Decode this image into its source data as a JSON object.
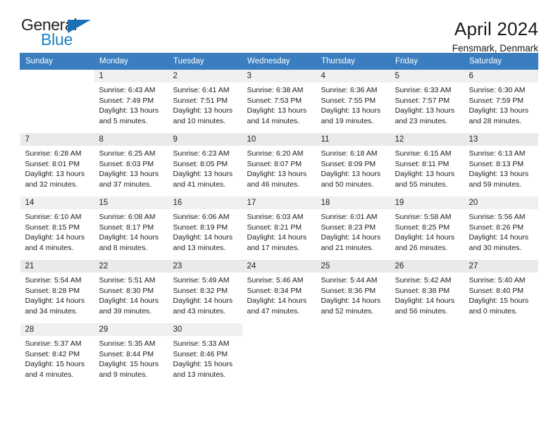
{
  "brand": {
    "name_top": "General",
    "name_bottom": "Blue",
    "triangle_color": "#1d70b8",
    "blue_color": "#1b81c4"
  },
  "header": {
    "month_title": "April 2024",
    "location": "Fensmark, Denmark"
  },
  "theme": {
    "header_bg": "#3a7ebf",
    "header_text": "#ffffff",
    "daynum_bg": "#f0f0f0",
    "daynum_bg_alt": "#eaeaea"
  },
  "weekdays": [
    "Sunday",
    "Monday",
    "Tuesday",
    "Wednesday",
    "Thursday",
    "Friday",
    "Saturday"
  ],
  "weeks": [
    [
      {
        "day": "",
        "sunrise": "",
        "sunset": "",
        "daylight_1": "",
        "daylight_2": "",
        "blank": true
      },
      {
        "day": "1",
        "sunrise": "Sunrise: 6:43 AM",
        "sunset": "Sunset: 7:49 PM",
        "daylight_1": "Daylight: 13 hours",
        "daylight_2": "and 5 minutes."
      },
      {
        "day": "2",
        "sunrise": "Sunrise: 6:41 AM",
        "sunset": "Sunset: 7:51 PM",
        "daylight_1": "Daylight: 13 hours",
        "daylight_2": "and 10 minutes."
      },
      {
        "day": "3",
        "sunrise": "Sunrise: 6:38 AM",
        "sunset": "Sunset: 7:53 PM",
        "daylight_1": "Daylight: 13 hours",
        "daylight_2": "and 14 minutes."
      },
      {
        "day": "4",
        "sunrise": "Sunrise: 6:36 AM",
        "sunset": "Sunset: 7:55 PM",
        "daylight_1": "Daylight: 13 hours",
        "daylight_2": "and 19 minutes."
      },
      {
        "day": "5",
        "sunrise": "Sunrise: 6:33 AM",
        "sunset": "Sunset: 7:57 PM",
        "daylight_1": "Daylight: 13 hours",
        "daylight_2": "and 23 minutes."
      },
      {
        "day": "6",
        "sunrise": "Sunrise: 6:30 AM",
        "sunset": "Sunset: 7:59 PM",
        "daylight_1": "Daylight: 13 hours",
        "daylight_2": "and 28 minutes."
      }
    ],
    [
      {
        "day": "7",
        "sunrise": "Sunrise: 6:28 AM",
        "sunset": "Sunset: 8:01 PM",
        "daylight_1": "Daylight: 13 hours",
        "daylight_2": "and 32 minutes."
      },
      {
        "day": "8",
        "sunrise": "Sunrise: 6:25 AM",
        "sunset": "Sunset: 8:03 PM",
        "daylight_1": "Daylight: 13 hours",
        "daylight_2": "and 37 minutes."
      },
      {
        "day": "9",
        "sunrise": "Sunrise: 6:23 AM",
        "sunset": "Sunset: 8:05 PM",
        "daylight_1": "Daylight: 13 hours",
        "daylight_2": "and 41 minutes."
      },
      {
        "day": "10",
        "sunrise": "Sunrise: 6:20 AM",
        "sunset": "Sunset: 8:07 PM",
        "daylight_1": "Daylight: 13 hours",
        "daylight_2": "and 46 minutes."
      },
      {
        "day": "11",
        "sunrise": "Sunrise: 6:18 AM",
        "sunset": "Sunset: 8:09 PM",
        "daylight_1": "Daylight: 13 hours",
        "daylight_2": "and 50 minutes."
      },
      {
        "day": "12",
        "sunrise": "Sunrise: 6:15 AM",
        "sunset": "Sunset: 8:11 PM",
        "daylight_1": "Daylight: 13 hours",
        "daylight_2": "and 55 minutes."
      },
      {
        "day": "13",
        "sunrise": "Sunrise: 6:13 AM",
        "sunset": "Sunset: 8:13 PM",
        "daylight_1": "Daylight: 13 hours",
        "daylight_2": "and 59 minutes."
      }
    ],
    [
      {
        "day": "14",
        "sunrise": "Sunrise: 6:10 AM",
        "sunset": "Sunset: 8:15 PM",
        "daylight_1": "Daylight: 14 hours",
        "daylight_2": "and 4 minutes."
      },
      {
        "day": "15",
        "sunrise": "Sunrise: 6:08 AM",
        "sunset": "Sunset: 8:17 PM",
        "daylight_1": "Daylight: 14 hours",
        "daylight_2": "and 8 minutes."
      },
      {
        "day": "16",
        "sunrise": "Sunrise: 6:06 AM",
        "sunset": "Sunset: 8:19 PM",
        "daylight_1": "Daylight: 14 hours",
        "daylight_2": "and 13 minutes."
      },
      {
        "day": "17",
        "sunrise": "Sunrise: 6:03 AM",
        "sunset": "Sunset: 8:21 PM",
        "daylight_1": "Daylight: 14 hours",
        "daylight_2": "and 17 minutes."
      },
      {
        "day": "18",
        "sunrise": "Sunrise: 6:01 AM",
        "sunset": "Sunset: 8:23 PM",
        "daylight_1": "Daylight: 14 hours",
        "daylight_2": "and 21 minutes."
      },
      {
        "day": "19",
        "sunrise": "Sunrise: 5:58 AM",
        "sunset": "Sunset: 8:25 PM",
        "daylight_1": "Daylight: 14 hours",
        "daylight_2": "and 26 minutes."
      },
      {
        "day": "20",
        "sunrise": "Sunrise: 5:56 AM",
        "sunset": "Sunset: 8:26 PM",
        "daylight_1": "Daylight: 14 hours",
        "daylight_2": "and 30 minutes."
      }
    ],
    [
      {
        "day": "21",
        "sunrise": "Sunrise: 5:54 AM",
        "sunset": "Sunset: 8:28 PM",
        "daylight_1": "Daylight: 14 hours",
        "daylight_2": "and 34 minutes."
      },
      {
        "day": "22",
        "sunrise": "Sunrise: 5:51 AM",
        "sunset": "Sunset: 8:30 PM",
        "daylight_1": "Daylight: 14 hours",
        "daylight_2": "and 39 minutes."
      },
      {
        "day": "23",
        "sunrise": "Sunrise: 5:49 AM",
        "sunset": "Sunset: 8:32 PM",
        "daylight_1": "Daylight: 14 hours",
        "daylight_2": "and 43 minutes."
      },
      {
        "day": "24",
        "sunrise": "Sunrise: 5:46 AM",
        "sunset": "Sunset: 8:34 PM",
        "daylight_1": "Daylight: 14 hours",
        "daylight_2": "and 47 minutes."
      },
      {
        "day": "25",
        "sunrise": "Sunrise: 5:44 AM",
        "sunset": "Sunset: 8:36 PM",
        "daylight_1": "Daylight: 14 hours",
        "daylight_2": "and 52 minutes."
      },
      {
        "day": "26",
        "sunrise": "Sunrise: 5:42 AM",
        "sunset": "Sunset: 8:38 PM",
        "daylight_1": "Daylight: 14 hours",
        "daylight_2": "and 56 minutes."
      },
      {
        "day": "27",
        "sunrise": "Sunrise: 5:40 AM",
        "sunset": "Sunset: 8:40 PM",
        "daylight_1": "Daylight: 15 hours",
        "daylight_2": "and 0 minutes."
      }
    ],
    [
      {
        "day": "28",
        "sunrise": "Sunrise: 5:37 AM",
        "sunset": "Sunset: 8:42 PM",
        "daylight_1": "Daylight: 15 hours",
        "daylight_2": "and 4 minutes."
      },
      {
        "day": "29",
        "sunrise": "Sunrise: 5:35 AM",
        "sunset": "Sunset: 8:44 PM",
        "daylight_1": "Daylight: 15 hours",
        "daylight_2": "and 9 minutes."
      },
      {
        "day": "30",
        "sunrise": "Sunrise: 5:33 AM",
        "sunset": "Sunset: 8:46 PM",
        "daylight_1": "Daylight: 15 hours",
        "daylight_2": "and 13 minutes."
      },
      {
        "day": "",
        "sunrise": "",
        "sunset": "",
        "daylight_1": "",
        "daylight_2": "",
        "blank": true
      },
      {
        "day": "",
        "sunrise": "",
        "sunset": "",
        "daylight_1": "",
        "daylight_2": "",
        "blank": true
      },
      {
        "day": "",
        "sunrise": "",
        "sunset": "",
        "daylight_1": "",
        "daylight_2": "",
        "blank": true
      },
      {
        "day": "",
        "sunrise": "",
        "sunset": "",
        "daylight_1": "",
        "daylight_2": "",
        "blank": true
      }
    ]
  ]
}
